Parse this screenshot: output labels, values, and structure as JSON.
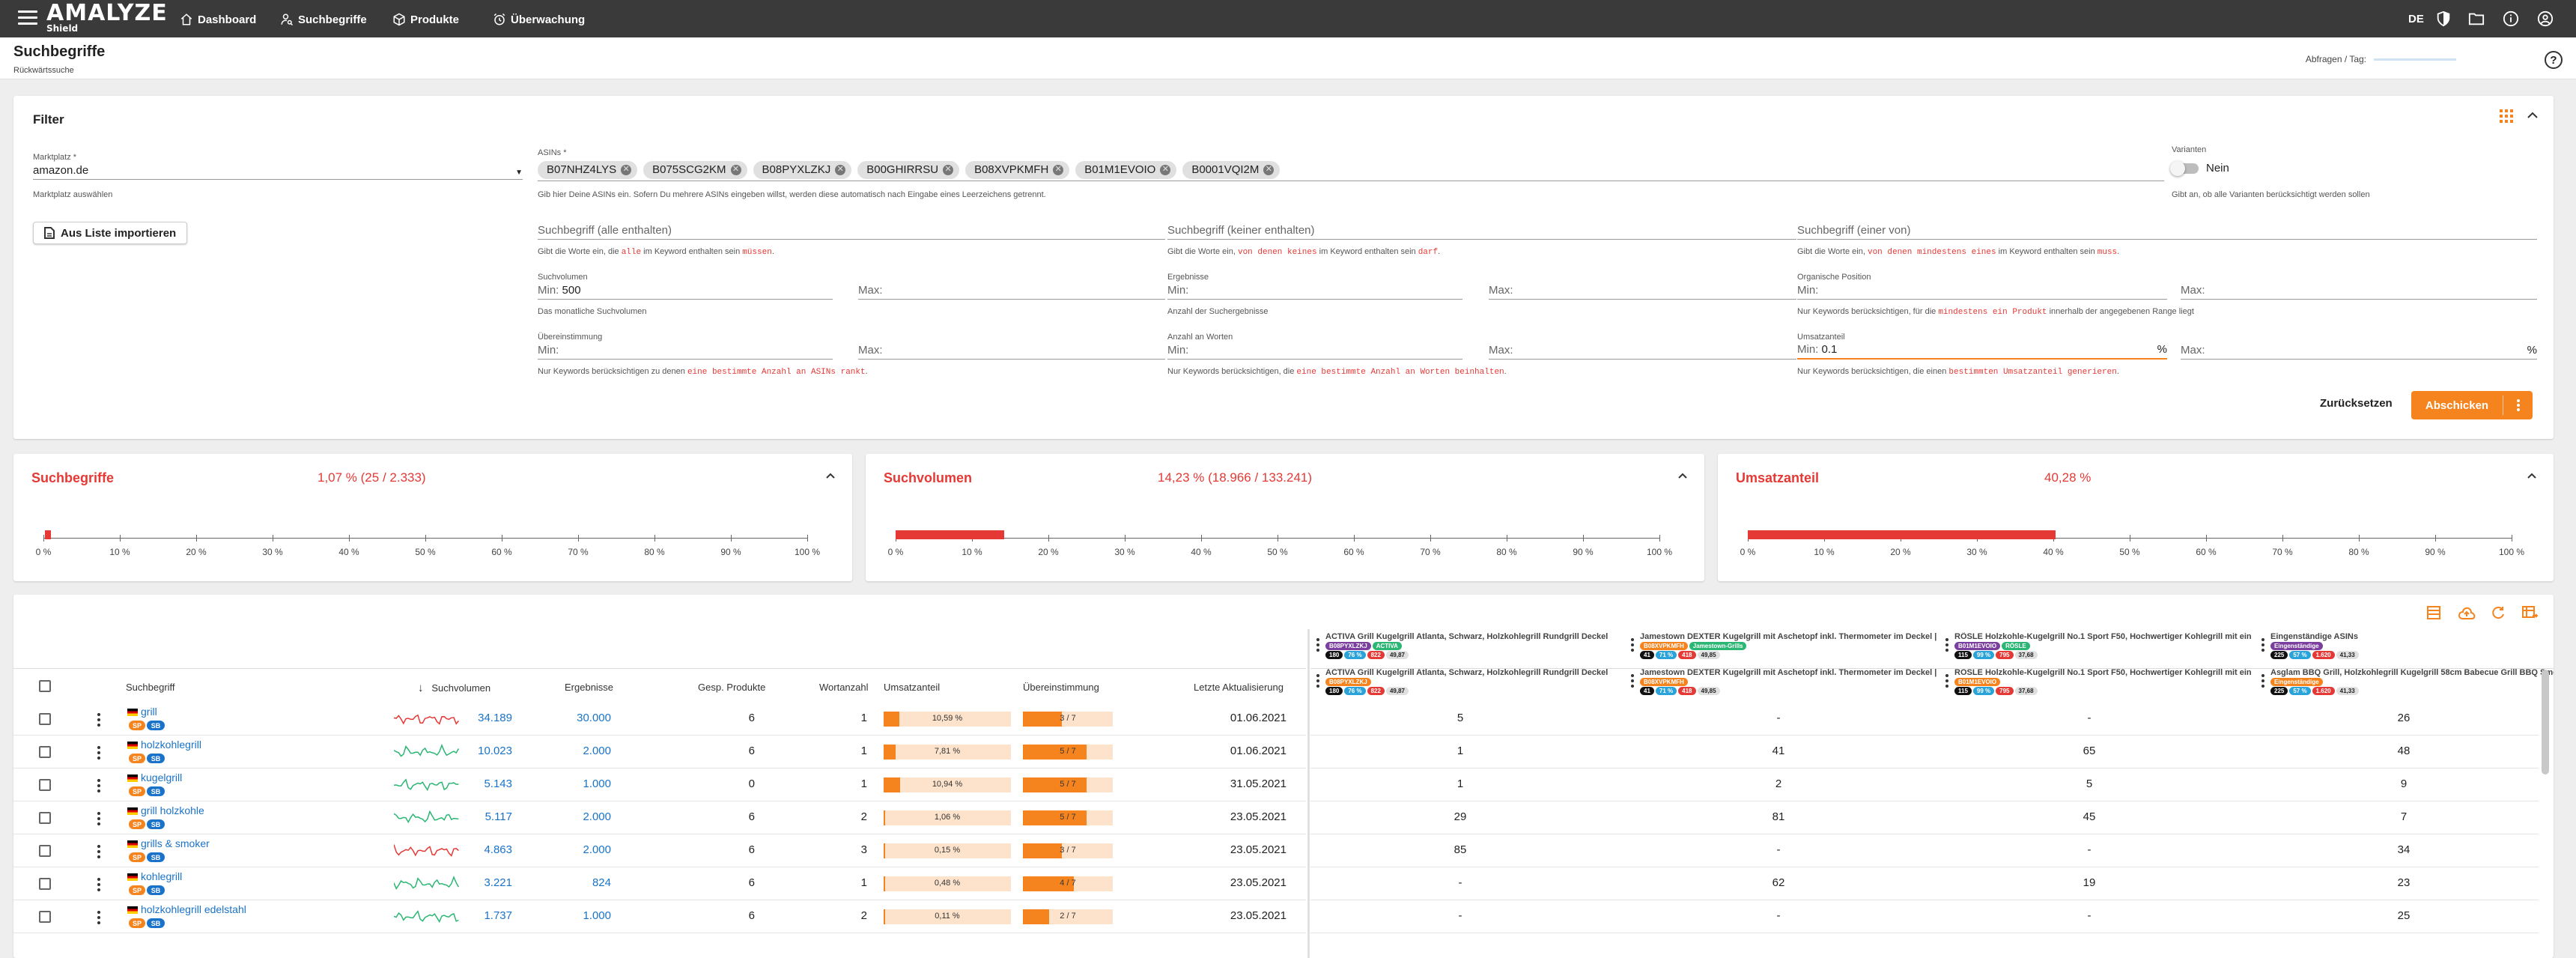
{
  "topbar": {
    "logo": "AMALYZE",
    "logo_sub": "Shield",
    "nav": [
      {
        "label": "Dashboard",
        "icon": "home-icon"
      },
      {
        "label": "Suchbegriffe",
        "icon": "person-search-icon"
      },
      {
        "label": "Produkte",
        "icon": "box-icon"
      },
      {
        "label": "Überwachung",
        "icon": "alarm-clock-icon"
      }
    ],
    "lang": "DE"
  },
  "header": {
    "title": "Suchbegriffe",
    "subtitle": "Rückwärtssuche",
    "quota_label": "Abfragen / Tag:",
    "help": "?"
  },
  "filter": {
    "title": "Filter",
    "marketplace_label": "Marktplatz *",
    "marketplace_value": "amazon.de",
    "marketplace_hint": "Marktplatz auswählen",
    "asins_label": "ASINs *",
    "asins": [
      "B07NHZ4LYS",
      "B075SCG2KM",
      "B08PYXLZKJ",
      "B00GHIRRSU",
      "B08XVPKMFH",
      "B01M1EVOIO",
      "B0001VQI2M"
    ],
    "asins_hint": "Gib hier Deine ASINs ein. Sofern Du mehrere ASINs eingeben willst, werden diese automatisch nach Eingabe eines Leerzeichens getrennt.",
    "variants_label": "Varianten",
    "variants_value": "Nein",
    "variants_hint": "Gibt an, ob alle Varianten berücksichtigt werden sollen",
    "import_button": "Aus Liste importieren",
    "kw_all_label": "Suchbegriff (alle enthalten)",
    "kw_all_hint_a": "Gibt die Worte ein, die",
    "kw_all_hint_b": "alle",
    "kw_all_hint_c": "im Keyword enthalten sein",
    "kw_all_hint_d": "müssen",
    "kw_none_label": "Suchbegriff (keiner enthalten)",
    "kw_none_hint_a": "Gibt die Worte ein,",
    "kw_none_hint_b": "von denen keines",
    "kw_none_hint_c": "im Keyword enthalten sein",
    "kw_none_hint_d": "darf",
    "kw_one_label": "Suchbegriff (einer von)",
    "kw_one_hint_a": "Gibt die Worte ein,",
    "kw_one_hint_b": "von denen mindestens eines",
    "kw_one_hint_c": "im Keyword enthalten sein",
    "kw_one_hint_d": "muss",
    "sv_label": "Suchvolumen",
    "sv_min_label": "Min:",
    "sv_min_value": "500",
    "sv_max_label": "Max:",
    "sv_hint": "Das monatliche Suchvolumen",
    "res_label": "Ergebnisse",
    "res_min_label": "Min:",
    "res_max_label": "Max:",
    "res_hint": "Anzahl der Suchergebnisse",
    "org_label": "Organische Position",
    "org_min_label": "Min:",
    "org_max_label": "Max:",
    "org_hint_a": "Nur Keywords berücksichtigen, für die",
    "org_hint_b": "mindestens ein Produkt",
    "org_hint_c": "innerhalb der angegebenen Range liegt",
    "match_label": "Übereinstimmung",
    "match_min_label": "Min:",
    "match_max_label": "Max:",
    "match_hint_a": "Nur Keywords berücksichtigen zu denen",
    "match_hint_b": "eine bestimmte Anzahl an ASINs rankt",
    "words_label": "Anzahl an Worten",
    "words_min_label": "Min:",
    "words_max_label": "Max:",
    "words_hint_a": "Nur Keywords berücksichtigen, die",
    "words_hint_b": "eine bestimmte Anzahl an Worten beinhalten",
    "rev_label": "Umsatzanteil",
    "rev_min_label": "Min:",
    "rev_min_value": "0.1",
    "rev_max_label": "Max:",
    "rev_unit": "%",
    "rev_hint_a": "Nur Keywords berücksichtigen, die einen",
    "rev_hint_b": "bestimmten Umsatzanteil generieren",
    "reset_button": "Zurücksetzen",
    "submit_button": "Abschicken"
  },
  "stats": [
    {
      "title": "Suchbegriffe",
      "value": "1,07 % (25 / 2.333)",
      "fraction": 0.0107
    },
    {
      "title": "Suchvolumen",
      "value": "14,23 % (18.966 / 133.241)",
      "fraction": 0.1423
    },
    {
      "title": "Umsatzanteil",
      "value": "40,28 %",
      "fraction": 0.4028
    }
  ],
  "axis_ticks": [
    "0 %",
    "10 %",
    "20 %",
    "30 %",
    "40 %",
    "50 %",
    "60 %",
    "70 %",
    "80 %",
    "90 %",
    "100 %"
  ],
  "table": {
    "headers": {
      "keyword": "Suchbegriff",
      "volume": "Suchvolumen",
      "results": "Ergebnisse",
      "products": "Gesp. Produkte",
      "words": "Wortanzahl",
      "share": "Umsatzanteil",
      "match": "Übereinstimmung",
      "updated": "Letzte Aktualisierung"
    },
    "badges": {
      "sp": "SP",
      "sb": "SB"
    },
    "rows": [
      {
        "keyword": "grill",
        "volume": "34.189",
        "results": "30.000",
        "products": "6",
        "words": "1",
        "share": "10,59 %",
        "share_val": 10.59,
        "match": "3 / 7",
        "match_val": 0.43,
        "updated": "01.06.2021",
        "trend": "red",
        "positions": [
          "5",
          "-",
          "-",
          "26"
        ]
      },
      {
        "keyword": "holzkohlegrill",
        "volume": "10.023",
        "results": "2.000",
        "products": "6",
        "words": "1",
        "share": "7,81 %",
        "share_val": 7.81,
        "match": "5 / 7",
        "match_val": 0.71,
        "updated": "01.06.2021",
        "trend": "green",
        "positions": [
          "1",
          "41",
          "65",
          "48"
        ]
      },
      {
        "keyword": "kugelgrill",
        "volume": "5.143",
        "results": "1.000",
        "products": "0",
        "words": "1",
        "share": "10,94 %",
        "share_val": 10.94,
        "match": "5 / 7",
        "match_val": 0.71,
        "updated": "31.05.2021",
        "trend": "green",
        "positions": [
          "1",
          "2",
          "5",
          "9"
        ]
      },
      {
        "keyword": "grill holzkohle",
        "volume": "5.117",
        "results": "2.000",
        "products": "6",
        "words": "2",
        "share": "1,06 %",
        "share_val": 1.06,
        "match": "5 / 7",
        "match_val": 0.71,
        "updated": "23.05.2021",
        "trend": "green",
        "positions": [
          "29",
          "81",
          "45",
          "7"
        ]
      },
      {
        "keyword": "grills & smoker",
        "volume": "4.863",
        "results": "2.000",
        "products": "6",
        "words": "3",
        "share": "0,15 %",
        "share_val": 0.15,
        "match": "3 / 7",
        "match_val": 0.43,
        "updated": "23.05.2021",
        "trend": "red",
        "positions": [
          "85",
          "-",
          "-",
          "34"
        ]
      },
      {
        "keyword": "kohlegrill",
        "volume": "3.221",
        "results": "824",
        "products": "6",
        "words": "1",
        "share": "0,48 %",
        "share_val": 0.48,
        "match": "4 / 7",
        "match_val": 0.57,
        "updated": "23.05.2021",
        "trend": "green",
        "positions": [
          "-",
          "62",
          "19",
          "23"
        ]
      },
      {
        "keyword": "holzkohlegrill edelstahl",
        "volume": "1.737",
        "results": "1.000",
        "products": "6",
        "words": "2",
        "share": "0,11 %",
        "share_val": 0.11,
        "match": "2 / 7",
        "match_val": 0.29,
        "updated": "23.05.2021",
        "trend": "green",
        "positions": [
          "-",
          "-",
          "-",
          "25"
        ]
      }
    ],
    "asin_cols": [
      {
        "title": "ACTIVA Grill Kugelgrill Atlanta, Schwarz, Holzkohlegrill Rundgrill Deckel",
        "badges": [
          "B08PYXLZKJ",
          "ACTIVA"
        ],
        "stats": [
          "180",
          "76 %",
          "822",
          "49,87"
        ],
        "title2": "ACTIVA Grill Kugelgrill Atlanta, Schwarz, Holzkohlegrill Rundgrill Deckel"
      },
      {
        "title": "Jamestown DEXTER Kugelgrill mit Aschetopf inkl. Thermometer im Deckel |",
        "badges": [
          "B08XVPKMFH",
          "Jamestown-Grills"
        ],
        "stats": [
          "41",
          "71 %",
          "418",
          "49,85"
        ],
        "title2": "Jamestown DEXTER Kugelgrill mit Aschetopf inkl. Thermometer im Deckel |"
      },
      {
        "title": "RÖSLE Holzkohle-Kugelgrill No.1 Sport F50, Hochwertiger Kohlegrill mit ein",
        "badges": [
          "B01M1EVOIO",
          "RÖSLE"
        ],
        "stats": [
          "115",
          "99 %",
          "795",
          "37,68"
        ],
        "title2": "RÖSLE Holzkohle-Kugelgrill No.1 Sport F50, Hochwertiger Kohlegrill mit ein"
      },
      {
        "title": "Eingenständige ASINs",
        "badges": [
          "Eingenständige"
        ],
        "stats": [
          "225",
          "57 %",
          "1.620",
          "41,33"
        ],
        "title2": "Asglam BBQ Grill, Holzkohlegrill Kugelgrill 58cm Babecue Grill BBQ Smoker"
      }
    ]
  }
}
